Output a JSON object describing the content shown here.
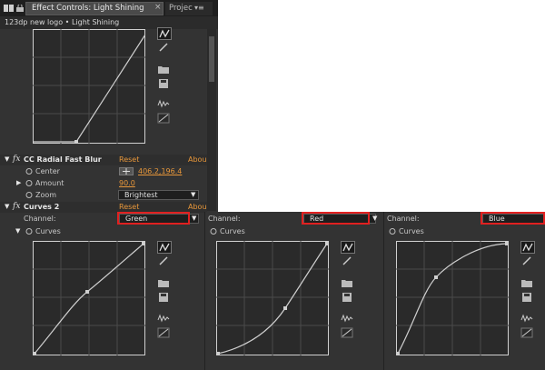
{
  "tabs": {
    "active_label": "Effect Controls: Light Shining",
    "close_glyph": "×",
    "project_label": "Projec",
    "menu_glyph": "▾≡"
  },
  "layer_path": "123dp new logo • Light Shining",
  "effects": {
    "radial_blur": {
      "name": "CC Radial Fast Blur",
      "reset": "Reset",
      "about": "Abou",
      "center_label": "Center",
      "center_value": "406.2,196.4",
      "amount_label": "Amount",
      "amount_value": "90.0",
      "zoom_label": "Zoom",
      "zoom_value": "Brightest"
    },
    "curves2": {
      "name": "Curves 2",
      "reset": "Reset",
      "about": "Abou",
      "channel_label": "Channel:",
      "curves_label": "Curves"
    }
  },
  "panels": [
    {
      "channel_label": "Channel:",
      "channel_value": "Green",
      "curves_label": "Curves"
    },
    {
      "channel_label": "Channel:",
      "channel_value": "Red",
      "curves_label": "Curves"
    },
    {
      "channel_label": "Channel:",
      "channel_value": "Blue",
      "curves_label": "Curves"
    }
  ],
  "icons": [
    "curve-tool-icon",
    "pencil-icon",
    "open-folder-icon",
    "save-icon",
    "smooth-icon",
    "reset-line-icon"
  ],
  "colors": {
    "panel_bg": "#333333",
    "highlight_red": "#e02020",
    "value_orange": "#e8973a"
  }
}
